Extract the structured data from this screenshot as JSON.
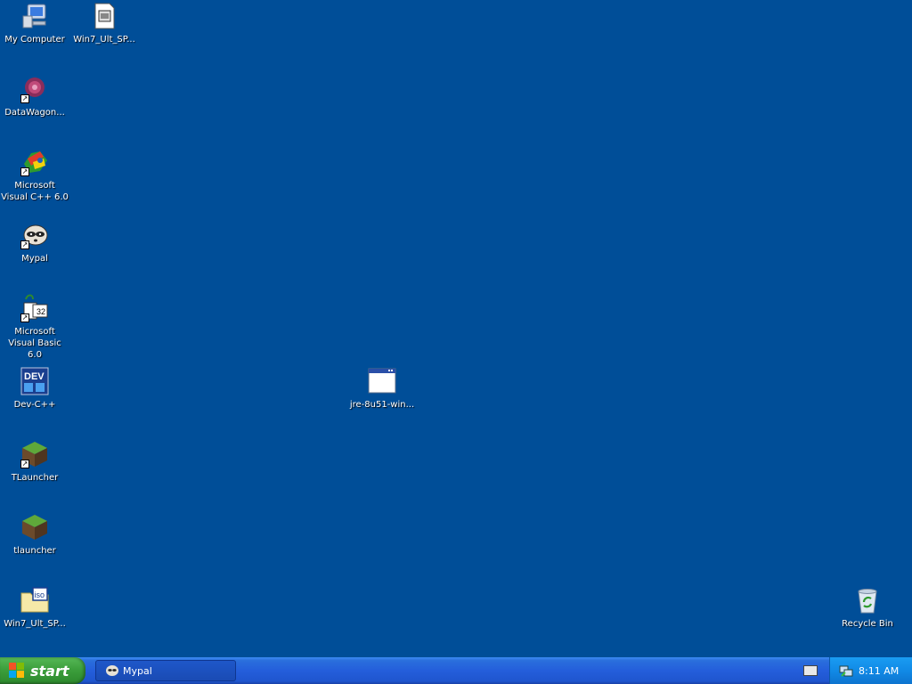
{
  "desktop": {
    "icons": [
      {
        "id": "my-computer",
        "label": "My Computer"
      },
      {
        "id": "win7-sp-1",
        "label": "Win7_Ult_SP..."
      },
      {
        "id": "datawagon",
        "label": "DataWagon..."
      },
      {
        "id": "msvc",
        "label": "Microsoft Visual C++ 6.0"
      },
      {
        "id": "mypal",
        "label": "Mypal"
      },
      {
        "id": "msvb",
        "label": "Microsoft Visual Basic 6.0"
      },
      {
        "id": "devcpp",
        "label": "Dev-C++"
      },
      {
        "id": "jre",
        "label": "jre-8u51-win..."
      },
      {
        "id": "tlauncher-shortcut",
        "label": "TLauncher"
      },
      {
        "id": "tlauncher",
        "label": "tlauncher"
      },
      {
        "id": "win7-iso",
        "label": "Win7_Ult_SP..."
      },
      {
        "id": "recycle-bin",
        "label": "Recycle Bin"
      }
    ],
    "iso_badge": "iso",
    "dev_badge": "DEV",
    "vb_badge": "32"
  },
  "taskbar": {
    "start_label": "start",
    "tasks": [
      {
        "label": "Mypal"
      }
    ],
    "clock": "8:11 AM"
  },
  "colors": {
    "desktop_bg": "#004e98",
    "taskbar_blue": "#245edb",
    "start_green": "#3c9f3c",
    "tray_blue": "#118ae6"
  }
}
